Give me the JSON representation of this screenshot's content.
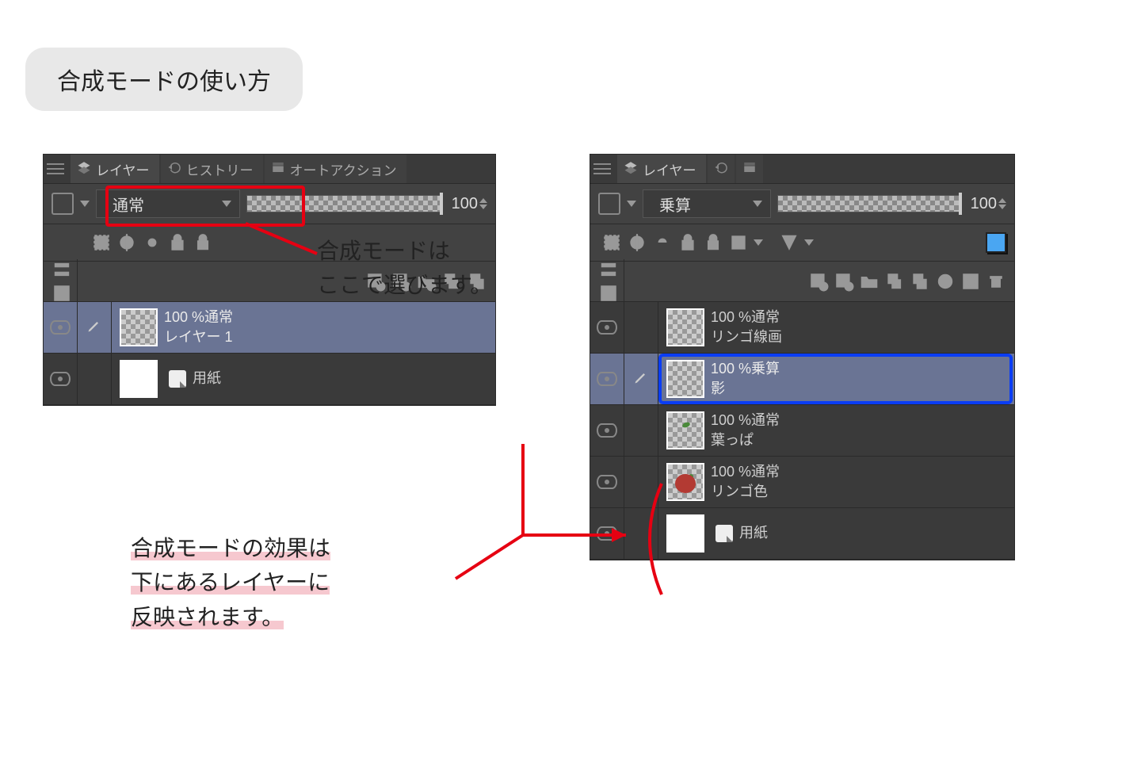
{
  "title": "合成モードの使い方",
  "annotations": {
    "callout_mode_line1": "合成モードは",
    "callout_mode_line2": "ここで選びます。",
    "effect_line1": "合成モードの効果は",
    "effect_line2": "下にあるレイヤーに",
    "effect_line3": "反映されます。"
  },
  "left_panel": {
    "tabs": {
      "layers": "レイヤー",
      "history": "ヒストリー",
      "autoaction": "オートアクション"
    },
    "blend_mode": "通常",
    "opacity": "100",
    "layers": [
      {
        "opacity_line": "100 %通常",
        "name": "レイヤー 1",
        "selected": true,
        "thumb": "checker"
      },
      {
        "name": "用紙",
        "paper": true,
        "thumb": "white"
      }
    ]
  },
  "right_panel": {
    "tabs": {
      "layers": "レイヤー"
    },
    "blend_mode": "乗算",
    "opacity": "100",
    "layers": [
      {
        "opacity_line": "100 %通常",
        "name": "リンゴ線画",
        "thumb": "checker"
      },
      {
        "opacity_line": "100 %乗算",
        "name": "影",
        "selected": true,
        "thumb": "checker"
      },
      {
        "opacity_line": "100 %通常",
        "name": "葉っぱ",
        "thumb": "leaf"
      },
      {
        "opacity_line": "100 %通常",
        "name": "リンゴ色",
        "thumb": "apple"
      },
      {
        "name": "用紙",
        "paper": true,
        "thumb": "white"
      }
    ]
  },
  "colors": {
    "highlight_red": "#e60012",
    "highlight_blue": "#0a3df5",
    "underline_pink": "#f6c8cf"
  }
}
